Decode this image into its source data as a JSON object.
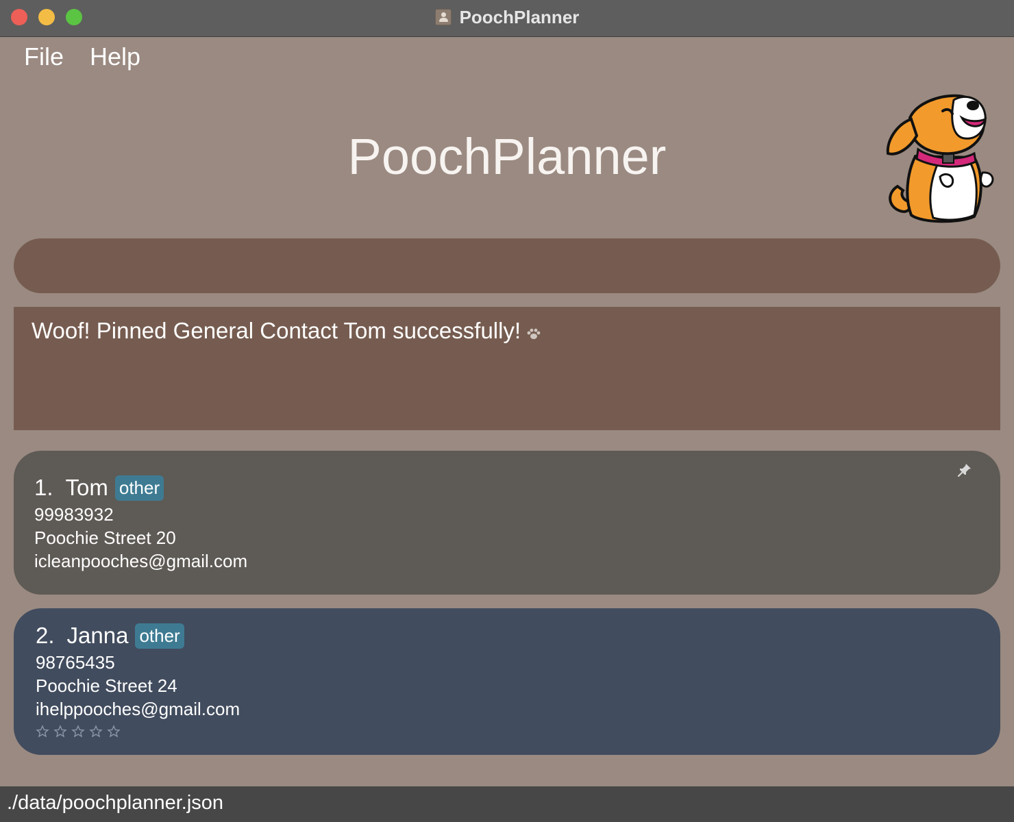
{
  "window": {
    "title": "PoochPlanner"
  },
  "menu": {
    "file": "File",
    "help": "Help"
  },
  "header": {
    "title": "PoochPlanner",
    "mascot_icon": "dog-mascot-icon"
  },
  "command": {
    "value": "",
    "placeholder": ""
  },
  "result": {
    "message": "Woof! Pinned General Contact Tom successfully!",
    "icon": "paw-icon"
  },
  "contacts": [
    {
      "index": "1.",
      "name": "Tom",
      "tag": "other",
      "phone": "99983932",
      "address": "Poochie Street 20",
      "email": "icleanpooches@gmail.com",
      "pinned": true
    },
    {
      "index": "2.",
      "name": "Janna",
      "tag": "other",
      "phone": "98765435",
      "address": "Poochie Street 24",
      "email": "ihelppooches@gmail.com",
      "rating": 0,
      "rating_max": 5
    }
  ],
  "status": {
    "path": "./data/poochplanner.json"
  },
  "colors": {
    "background": "#9a8a81",
    "panel": "#765c50",
    "pinned_card": "#5e5a55",
    "card": "#414c5e",
    "tag": "#3e7b93"
  }
}
